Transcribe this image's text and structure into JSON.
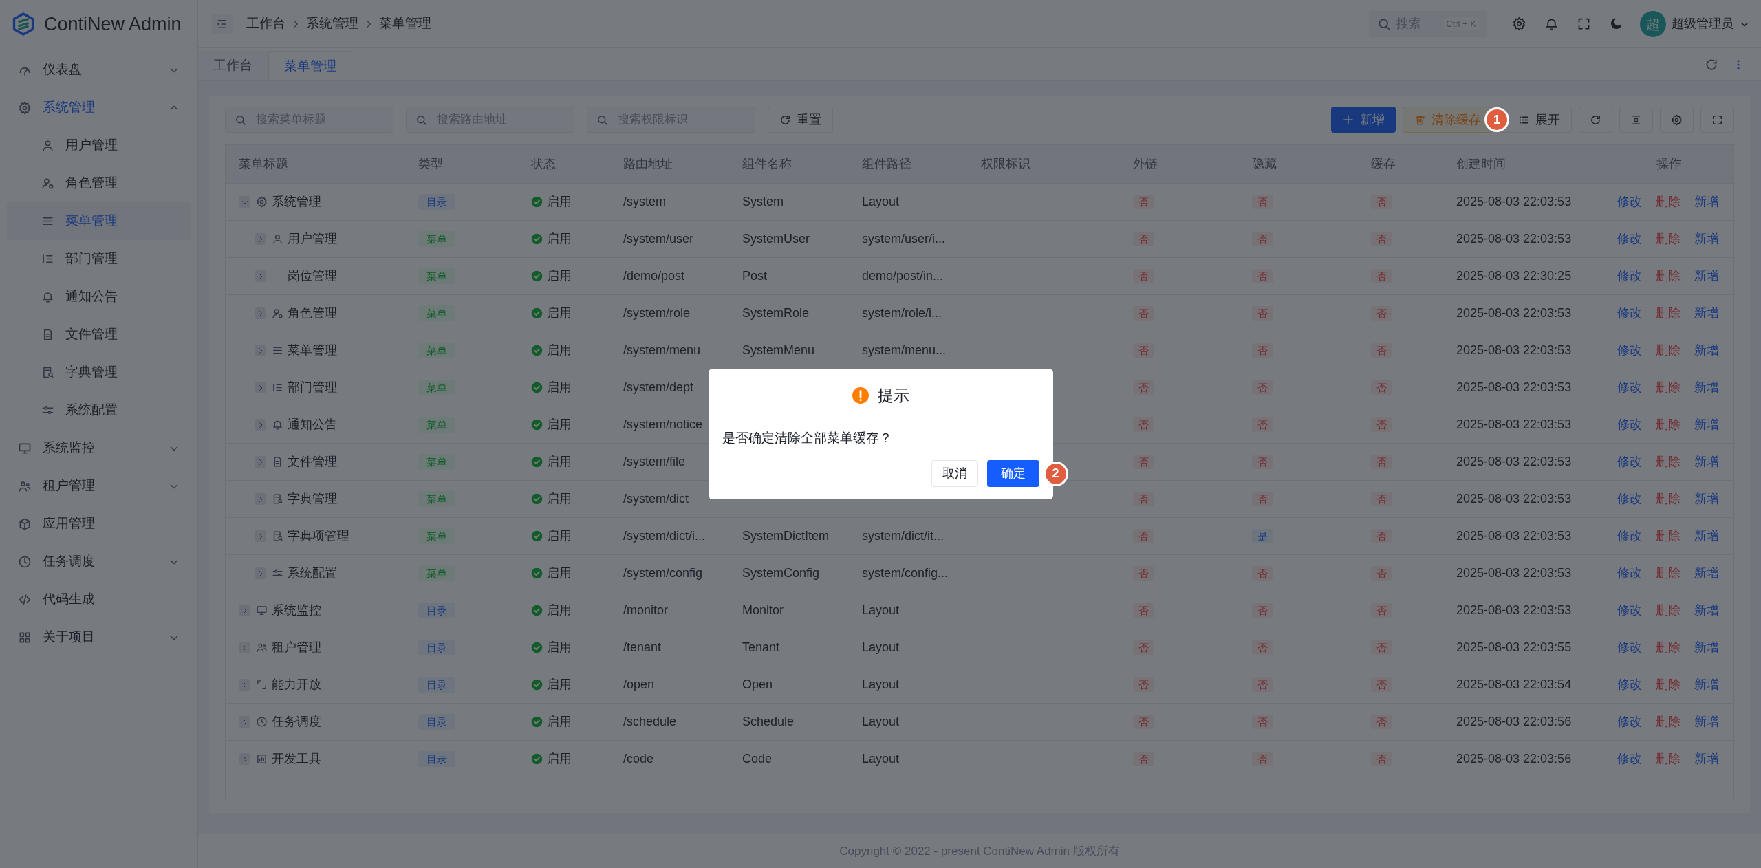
{
  "sidebar": {
    "logo_text": "ContiNew Admin",
    "items": [
      {
        "label": "仪表盘",
        "selected": false,
        "expanded": false
      },
      {
        "label": "系统管理",
        "selected": true,
        "expanded": true,
        "children": [
          {
            "label": "用户管理",
            "selected": false
          },
          {
            "label": "角色管理",
            "selected": false
          },
          {
            "label": "菜单管理",
            "selected": true
          },
          {
            "label": "部门管理",
            "selected": false
          },
          {
            "label": "通知公告",
            "selected": false
          },
          {
            "label": "文件管理",
            "selected": false
          },
          {
            "label": "字典管理",
            "selected": false
          },
          {
            "label": "系统配置",
            "selected": false
          }
        ]
      },
      {
        "label": "系统监控",
        "selected": false,
        "expanded": false
      },
      {
        "label": "租户管理",
        "selected": false,
        "expanded": false
      },
      {
        "label": "应用管理",
        "selected": false
      },
      {
        "label": "任务调度",
        "selected": false,
        "expanded": false
      },
      {
        "label": "代码生成",
        "selected": false
      },
      {
        "label": "关于项目",
        "selected": false,
        "expanded": false
      }
    ]
  },
  "header": {
    "breadcrumb": [
      "工作台",
      "系统管理",
      "菜单管理"
    ],
    "search": {
      "label": "搜索",
      "shortcut": "Ctrl + K"
    },
    "avatar": "超",
    "user": "超级管理员"
  },
  "tabs": [
    {
      "label": "工作台",
      "selected": false
    },
    {
      "label": "菜单管理",
      "selected": true
    }
  ],
  "filters": {
    "fields": [
      {
        "placeholder": "搜索菜单标题"
      },
      {
        "placeholder": "搜索路由地址"
      },
      {
        "placeholder": "搜索权限标识"
      }
    ],
    "reset": "重置"
  },
  "toolbar": {
    "add": "新增",
    "clear_cache": "清除缓存",
    "expand": "展开"
  },
  "table": {
    "columns": [
      "菜单标题",
      "类型",
      "状态",
      "路由地址",
      "组件名称",
      "组件路径",
      "权限标识",
      "外链",
      "隐藏",
      "缓存",
      "创建时间",
      "操作"
    ],
    "rows": [
      {
        "title": "系统管理",
        "type": {
          "label": "目录",
          "kind": "directory"
        },
        "status": "启用",
        "route": "/system",
        "component_name": "System",
        "component_path": "Layout",
        "external": {
          "label": "否",
          "on": false
        },
        "hidden": {
          "label": "否",
          "on": false
        },
        "cache": {
          "label": "否",
          "on": false
        },
        "created": "2025-08-03 22:03:53",
        "actions": [
          {
            "label": "修改",
            "kind": "edit"
          },
          {
            "label": "删除",
            "kind": "delete"
          },
          {
            "label": "新增",
            "kind": "add"
          }
        ],
        "expanded": true,
        "children": [
          {
            "title": "用户管理",
            "type": {
              "label": "菜单",
              "kind": "menu"
            },
            "status": "启用",
            "route": "/system/user",
            "component_name": "SystemUser",
            "component_path": "system/user/i...",
            "external": {
              "label": "否",
              "on": false
            },
            "hidden": {
              "label": "否",
              "on": false
            },
            "cache": {
              "label": "否",
              "on": false
            },
            "created": "2025-08-03 22:03:53",
            "actions": [
              {
                "label": "修改",
                "kind": "edit"
              },
              {
                "label": "删除",
                "kind": "delete"
              },
              {
                "label": "新增",
                "kind": "add"
              }
            ],
            "expanded": false
          },
          {
            "title": "岗位管理",
            "type": {
              "label": "菜单",
              "kind": "menu"
            },
            "status": "启用",
            "route": "/demo/post",
            "component_name": "Post",
            "component_path": "demo/post/in...",
            "external": {
              "label": "否",
              "on": false
            },
            "hidden": {
              "label": "否",
              "on": false
            },
            "cache": {
              "label": "否",
              "on": false
            },
            "created": "2025-08-03 22:30:25",
            "actions": [
              {
                "label": "修改",
                "kind": "edit"
              },
              {
                "label": "删除",
                "kind": "delete"
              },
              {
                "label": "新增",
                "kind": "add"
              }
            ],
            "expanded": false
          },
          {
            "title": "角色管理",
            "type": {
              "label": "菜单",
              "kind": "menu"
            },
            "status": "启用",
            "route": "/system/role",
            "component_name": "SystemRole",
            "component_path": "system/role/i...",
            "external": {
              "label": "否",
              "on": false
            },
            "hidden": {
              "label": "否",
              "on": false
            },
            "cache": {
              "label": "否",
              "on": false
            },
            "created": "2025-08-03 22:03:53",
            "actions": [
              {
                "label": "修改",
                "kind": "edit"
              },
              {
                "label": "删除",
                "kind": "delete"
              },
              {
                "label": "新增",
                "kind": "add"
              }
            ],
            "expanded": false
          },
          {
            "title": "菜单管理",
            "type": {
              "label": "菜单",
              "kind": "menu"
            },
            "status": "启用",
            "route": "/system/menu",
            "component_name": "SystemMenu",
            "component_path": "system/menu...",
            "external": {
              "label": "否",
              "on": false
            },
            "hidden": {
              "label": "否",
              "on": false
            },
            "cache": {
              "label": "否",
              "on": false
            },
            "created": "2025-08-03 22:03:53",
            "actions": [
              {
                "label": "修改",
                "kind": "edit"
              },
              {
                "label": "删除",
                "kind": "delete"
              },
              {
                "label": "新增",
                "kind": "add"
              }
            ],
            "expanded": false
          },
          {
            "title": "部门管理",
            "type": {
              "label": "菜单",
              "kind": "menu"
            },
            "status": "启用",
            "route": "/system/dept",
            "external": {
              "label": "否",
              "on": false
            },
            "hidden": {
              "label": "否",
              "on": false
            },
            "cache": {
              "label": "否",
              "on": false
            },
            "created": "2025-08-03 22:03:53",
            "actions": [
              {
                "label": "修改",
                "kind": "edit"
              },
              {
                "label": "删除",
                "kind": "delete"
              },
              {
                "label": "新增",
                "kind": "add"
              }
            ],
            "expanded": false
          },
          {
            "title": "通知公告",
            "type": {
              "label": "菜单",
              "kind": "menu"
            },
            "status": "启用",
            "route": "/system/notice",
            "external": {
              "label": "否",
              "on": false
            },
            "hidden": {
              "label": "否",
              "on": false
            },
            "cache": {
              "label": "否",
              "on": false
            },
            "created": "2025-08-03 22:03:53",
            "actions": [
              {
                "label": "修改",
                "kind": "edit"
              },
              {
                "label": "删除",
                "kind": "delete"
              },
              {
                "label": "新增",
                "kind": "add"
              }
            ],
            "expanded": false
          },
          {
            "title": "文件管理",
            "type": {
              "label": "菜单",
              "kind": "menu"
            },
            "status": "启用",
            "route": "/system/file",
            "external": {
              "label": "否",
              "on": false
            },
            "hidden": {
              "label": "否",
              "on": false
            },
            "cache": {
              "label": "否",
              "on": false
            },
            "created": "2025-08-03 22:03:53",
            "actions": [
              {
                "label": "修改",
                "kind": "edit"
              },
              {
                "label": "删除",
                "kind": "delete"
              },
              {
                "label": "新增",
                "kind": "add"
              }
            ],
            "expanded": false
          },
          {
            "title": "字典管理",
            "type": {
              "label": "菜单",
              "kind": "menu"
            },
            "status": "启用",
            "route": "/system/dict",
            "external": {
              "label": "否",
              "on": false
            },
            "hidden": {
              "label": "否",
              "on": false
            },
            "cache": {
              "label": "否",
              "on": false
            },
            "created": "2025-08-03 22:03:53",
            "actions": [
              {
                "label": "修改",
                "kind": "edit"
              },
              {
                "label": "删除",
                "kind": "delete"
              },
              {
                "label": "新增",
                "kind": "add"
              }
            ],
            "expanded": false
          },
          {
            "title": "字典项管理",
            "type": {
              "label": "菜单",
              "kind": "menu"
            },
            "status": "启用",
            "route": "/system/dict/i...",
            "component_name": "SystemDictItem",
            "component_path": "system/dict/it...",
            "external": {
              "label": "否",
              "on": false
            },
            "hidden": {
              "label": "是",
              "on": true
            },
            "cache": {
              "label": "否",
              "on": false
            },
            "created": "2025-08-03 22:03:53",
            "actions": [
              {
                "label": "修改",
                "kind": "edit"
              },
              {
                "label": "删除",
                "kind": "delete"
              },
              {
                "label": "新增",
                "kind": "add"
              }
            ],
            "expanded": false
          },
          {
            "title": "系统配置",
            "type": {
              "label": "菜单",
              "kind": "menu"
            },
            "status": "启用",
            "route": "/system/config",
            "component_name": "SystemConfig",
            "component_path": "system/config...",
            "external": {
              "label": "否",
              "on": false
            },
            "hidden": {
              "label": "否",
              "on": false
            },
            "cache": {
              "label": "否",
              "on": false
            },
            "created": "2025-08-03 22:03:53",
            "actions": [
              {
                "label": "修改",
                "kind": "edit"
              },
              {
                "label": "删除",
                "kind": "delete"
              },
              {
                "label": "新增",
                "kind": "add"
              }
            ],
            "expanded": false
          }
        ]
      },
      {
        "title": "系统监控",
        "type": {
          "label": "目录",
          "kind": "directory"
        },
        "status": "启用",
        "route": "/monitor",
        "component_name": "Monitor",
        "component_path": "Layout",
        "external": {
          "label": "否",
          "on": false
        },
        "hidden": {
          "label": "否",
          "on": false
        },
        "cache": {
          "label": "否",
          "on": false
        },
        "created": "2025-08-03 22:03:53",
        "actions": [
          {
            "label": "修改",
            "kind": "edit"
          },
          {
            "label": "删除",
            "kind": "delete"
          },
          {
            "label": "新增",
            "kind": "add"
          }
        ],
        "expanded": false
      },
      {
        "title": "租户管理",
        "type": {
          "label": "目录",
          "kind": "directory"
        },
        "status": "启用",
        "route": "/tenant",
        "component_name": "Tenant",
        "component_path": "Layout",
        "external": {
          "label": "否",
          "on": false
        },
        "hidden": {
          "label": "否",
          "on": false
        },
        "cache": {
          "label": "否",
          "on": false
        },
        "created": "2025-08-03 22:03:55",
        "actions": [
          {
            "label": "修改",
            "kind": "edit"
          },
          {
            "label": "删除",
            "kind": "delete"
          },
          {
            "label": "新增",
            "kind": "add"
          }
        ],
        "expanded": false
      },
      {
        "title": "能力开放",
        "type": {
          "label": "目录",
          "kind": "directory"
        },
        "status": "启用",
        "route": "/open",
        "component_name": "Open",
        "component_path": "Layout",
        "external": {
          "label": "否",
          "on": false
        },
        "hidden": {
          "label": "否",
          "on": false
        },
        "cache": {
          "label": "否",
          "on": false
        },
        "created": "2025-08-03 22:03:54",
        "actions": [
          {
            "label": "修改",
            "kind": "edit"
          },
          {
            "label": "删除",
            "kind": "delete"
          },
          {
            "label": "新增",
            "kind": "add"
          }
        ],
        "expanded": false
      },
      {
        "title": "任务调度",
        "type": {
          "label": "目录",
          "kind": "directory"
        },
        "status": "启用",
        "route": "/schedule",
        "component_name": "Schedule",
        "component_path": "Layout",
        "external": {
          "label": "否",
          "on": false
        },
        "hidden": {
          "label": "否",
          "on": false
        },
        "cache": {
          "label": "否",
          "on": false
        },
        "created": "2025-08-03 22:03:56",
        "actions": [
          {
            "label": "修改",
            "kind": "edit"
          },
          {
            "label": "删除",
            "kind": "delete"
          },
          {
            "label": "新增",
            "kind": "add"
          }
        ],
        "expanded": false
      },
      {
        "title": "开发工具",
        "type": {
          "label": "目录",
          "kind": "directory"
        },
        "status": "启用",
        "route": "/code",
        "component_name": "Code",
        "component_path": "Layout",
        "external": {
          "label": "否",
          "on": false
        },
        "hidden": {
          "label": "否",
          "on": false
        },
        "cache": {
          "label": "否",
          "on": false
        },
        "created": "2025-08-03 22:03:56",
        "actions": [
          {
            "label": "修改",
            "kind": "edit"
          },
          {
            "label": "删除",
            "kind": "delete"
          },
          {
            "label": "新增",
            "kind": "add"
          }
        ],
        "expanded": false
      }
    ]
  },
  "footer": "Copyright © 2022 - present ContiNew Admin 版权所有",
  "dialog": {
    "title": "提示",
    "message": "是否确定清除全部菜单缓存？",
    "cancel": "取消",
    "confirm": "确定"
  },
  "step_markers": [
    "1",
    "2"
  ]
}
